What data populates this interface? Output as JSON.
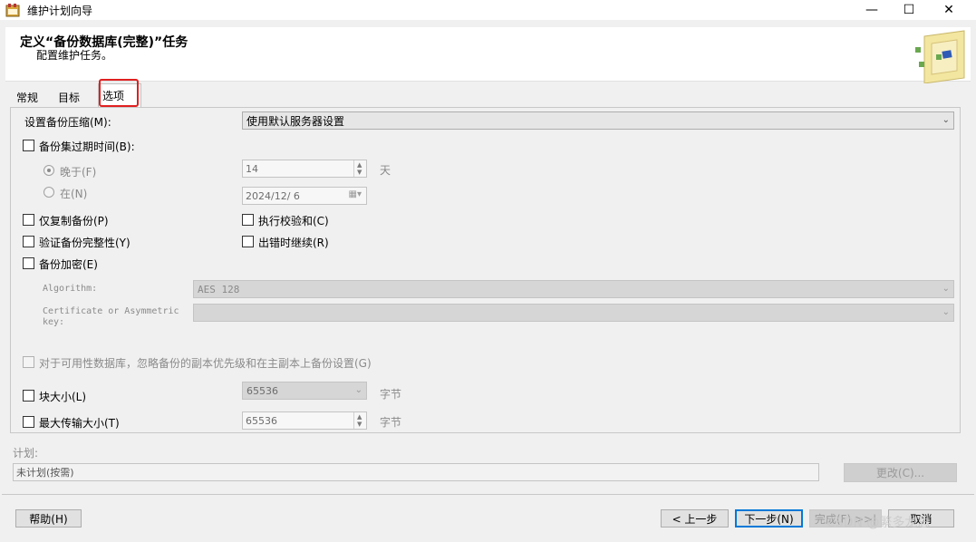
{
  "window": {
    "title": "维护计划向导",
    "controls": {
      "minimize": "—",
      "maximize": "☐",
      "close": "✕"
    }
  },
  "header": {
    "title": "定义“备份数据库(完整)”任务",
    "subtitle": "配置维护任务。"
  },
  "tabs": [
    {
      "label": "常规",
      "active": false
    },
    {
      "label": "目标",
      "active": false
    },
    {
      "label": "选项",
      "active": true
    }
  ],
  "options": {
    "compression": {
      "label": "设置备份压缩(M):",
      "value": "使用默认服务器设置"
    },
    "expire": {
      "label": "备份集过期时间(B):",
      "after_label": "晚于(F)",
      "after_value": "14",
      "after_unit": "天",
      "on_label": "在(N)",
      "on_value": "2024/12/ 6"
    },
    "copy_only": {
      "label": "仅复制备份(P)"
    },
    "checksum": {
      "label": "执行校验和(C)"
    },
    "verify": {
      "label": "验证备份完整性(Y)"
    },
    "continue_on_error": {
      "label": "出错时继续(R)"
    },
    "encrypt": {
      "label": "备份加密(E)",
      "algorithm_label": "Algorithm:",
      "algorithm_value": "AES 128",
      "cert_label_line1": "Certificate or Asymmetric",
      "cert_label_line2": "key:",
      "cert_value": ""
    },
    "availability": {
      "label": "对于可用性数据库，忽略备份的副本优先级和在主副本上备份设置(G)"
    },
    "block_size": {
      "label": "块大小(L)",
      "value": "65536",
      "unit": "字节"
    },
    "max_transfer": {
      "label": "最大传输大小(T)",
      "value": "65536",
      "unit": "字节"
    }
  },
  "schedule": {
    "label": "计划:",
    "value": "未计划(按需)",
    "change_button": "更改(C)..."
  },
  "footer": {
    "help": "帮助(H)",
    "back": "< 上一步",
    "next": "下一步(N)",
    "finish": "完成(F) >>|",
    "cancel": "取消"
  },
  "watermark": "CSDN @繁多龙思",
  "colors": {
    "highlight_box": "#e02020",
    "primary_border": "#0078d7"
  }
}
